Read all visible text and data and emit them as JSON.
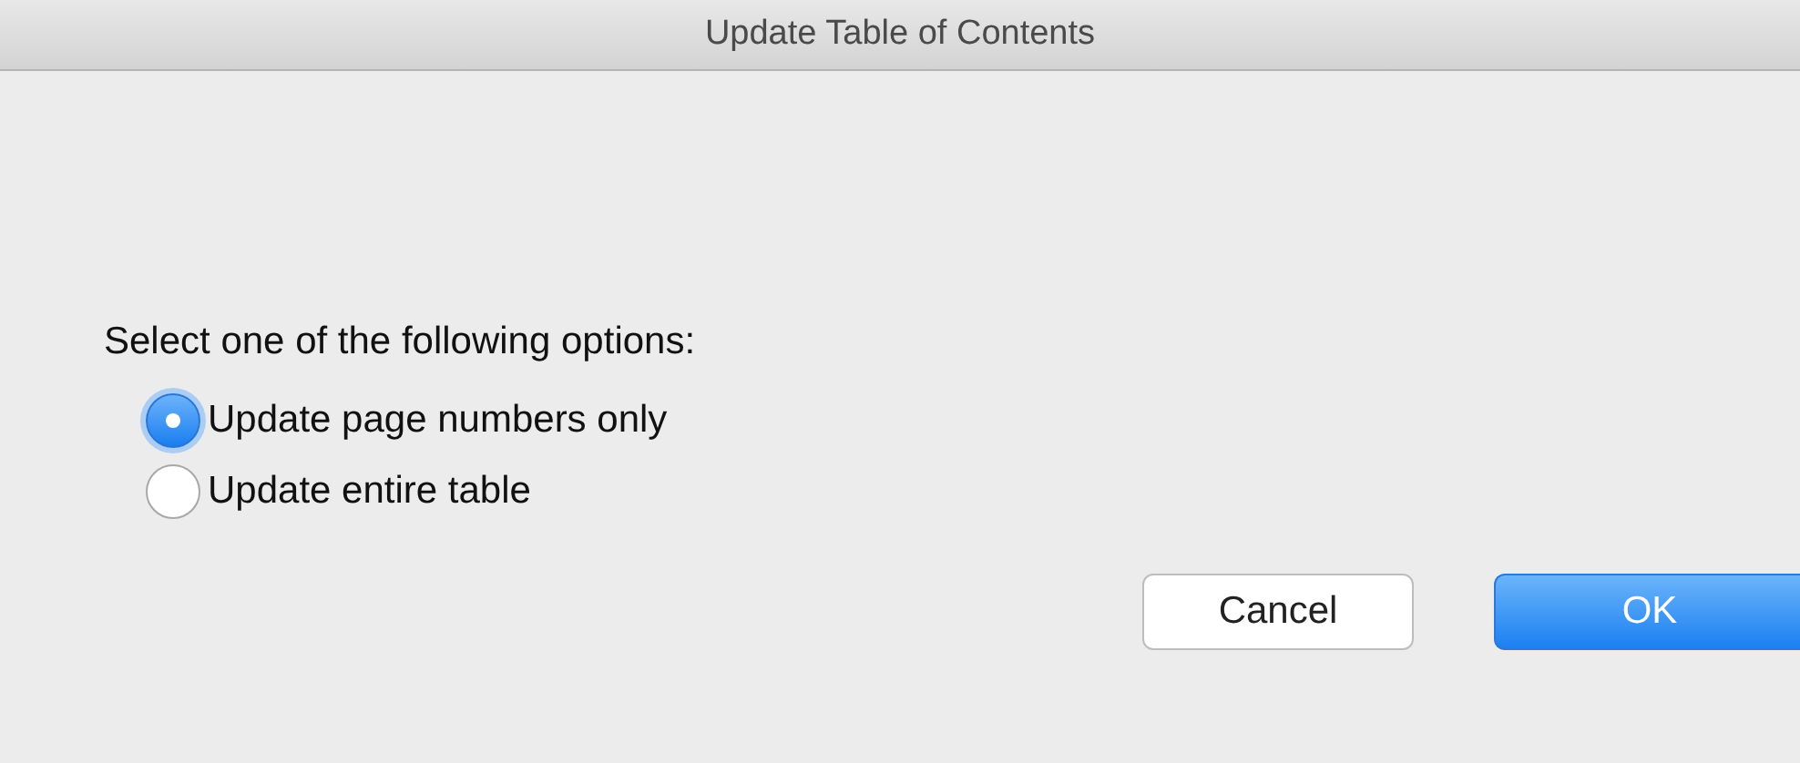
{
  "window": {
    "title": "Update Table of Contents"
  },
  "prompt": "Select one of the following options:",
  "options": [
    {
      "label": "Update page numbers only",
      "selected": true
    },
    {
      "label": "Update entire table",
      "selected": false
    }
  ],
  "buttons": [
    {
      "label": "Cancel",
      "kind": "secondary"
    },
    {
      "label": "OK",
      "kind": "default"
    }
  ]
}
